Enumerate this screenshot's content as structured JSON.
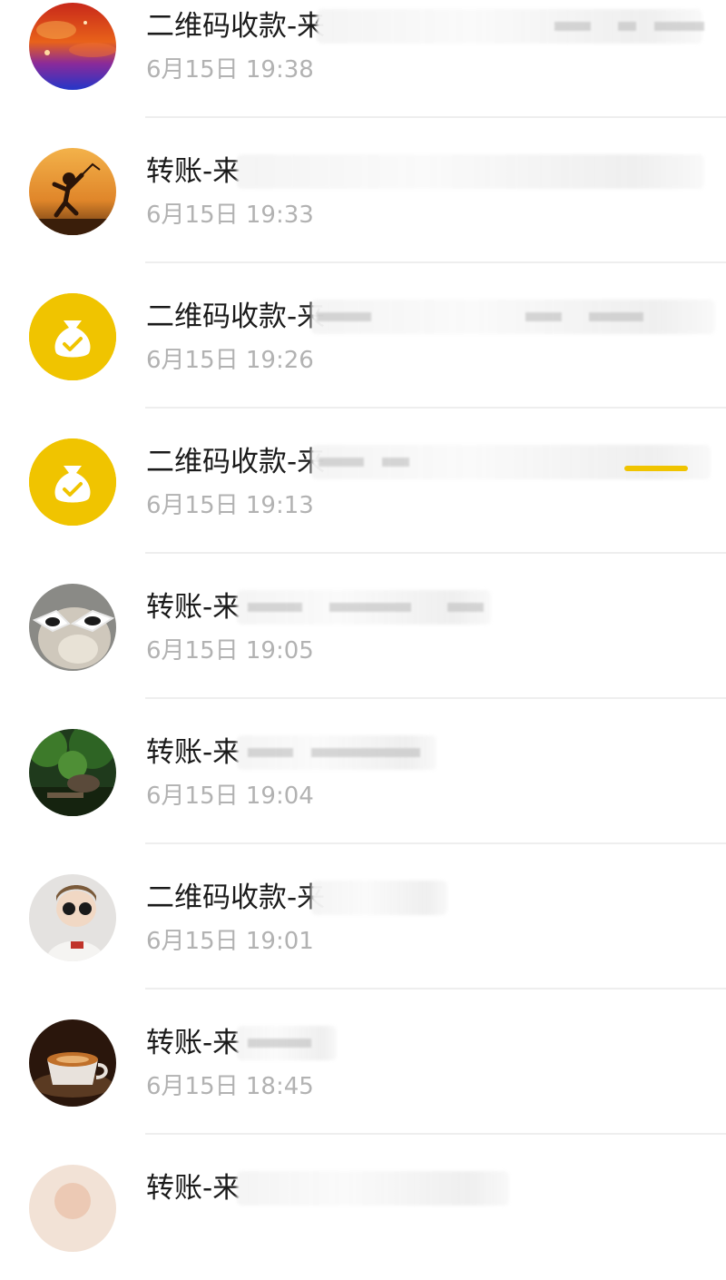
{
  "colors": {
    "title_text": "#1b1b1b",
    "time_text": "#b2b2b2",
    "divider": "#eeeeee",
    "app_icon_bg": "#f0c400",
    "background": "#ffffff"
  },
  "transactions": [
    {
      "title": "二维码收款-来",
      "time": "6月15日 19:38",
      "avatar": "sunset-sky-photo"
    },
    {
      "title": "转账-来",
      "time": "6月15日 19:33",
      "avatar": "running-child-sunset-photo"
    },
    {
      "title": "二维码收款-来",
      "time": "6月15日 19:26",
      "avatar": "money-bag-icon"
    },
    {
      "title": "二维码收款-来",
      "time": "6月15日 19:13",
      "avatar": "money-bag-icon"
    },
    {
      "title": "转账-来",
      "time": "6月15日 19:05",
      "avatar": "cat-with-sunglasses-photo"
    },
    {
      "title": "转账-来",
      "time": "6月15日 19:04",
      "avatar": "forest-scene-photo"
    },
    {
      "title": "二维码收款-来",
      "time": "6月15日 19:01",
      "avatar": "child-with-sunglasses-photo"
    },
    {
      "title": "转账-来",
      "time": "6月15日 18:45",
      "avatar": "coffee-cup-photo"
    },
    {
      "title": "转账-来",
      "time": "",
      "avatar": "portrait-photo"
    }
  ]
}
